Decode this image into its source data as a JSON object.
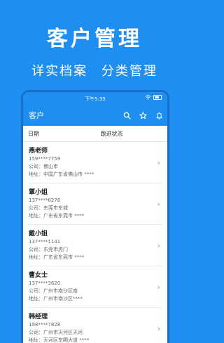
{
  "hero": {
    "title": "客户管理",
    "subtitle_left": "详实档案",
    "subtitle_right": "分类管理"
  },
  "status_bar": {
    "time": "下午5:35"
  },
  "app_bar": {
    "title": "客户"
  },
  "tabs": [
    {
      "label": "日期"
    },
    {
      "label": "跟进状态"
    }
  ],
  "customers": [
    {
      "name": "燕老师",
      "phone": "159****7759",
      "company": "公司：佛山市",
      "address": "地址：中国广东省佛山市 ****"
    },
    {
      "name": "覃小姐",
      "phone": "137****6278",
      "company": "公司：东莞市东城",
      "address": "地址：广东省东莞市 ****"
    },
    {
      "name": "戴小姐",
      "phone": "137****1141",
      "company": "公司：东莞市虎门",
      "address": "地址：广东省东莞市 ****"
    },
    {
      "name": "曹女士",
      "phone": "137****3620",
      "company": "公司：广州市南沙区南",
      "address": "地址：广州市南沙区****"
    },
    {
      "name": "韩经理",
      "phone": "198****7828",
      "company": "公司：广州市天河区天河",
      "address": "地址：天河区东圃大道 ****"
    }
  ],
  "colors": {
    "brand": "#1E8FF0",
    "frame": "#1570c9"
  }
}
